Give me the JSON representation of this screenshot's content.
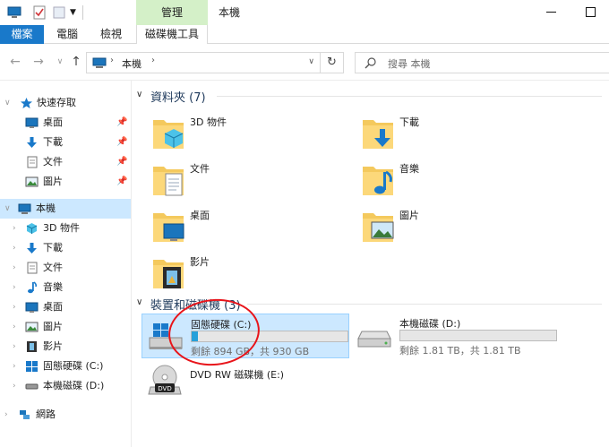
{
  "titlebar": {
    "context_group": "管理",
    "title": "本機"
  },
  "ribbon": {
    "tabs": [
      {
        "label": "檔案"
      },
      {
        "label": "電腦"
      },
      {
        "label": "檢視"
      },
      {
        "label": "磁碟機工具"
      }
    ]
  },
  "address": {
    "location": "本機"
  },
  "search": {
    "placeholder": "搜尋 本機"
  },
  "navpane": {
    "quick_access": "快速存取",
    "quick_items": [
      {
        "label": "桌面"
      },
      {
        "label": "下載"
      },
      {
        "label": "文件"
      },
      {
        "label": "圖片"
      }
    ],
    "this_pc": "本機",
    "pc_items": [
      {
        "label": "3D 物件"
      },
      {
        "label": "下載"
      },
      {
        "label": "文件"
      },
      {
        "label": "音樂"
      },
      {
        "label": "桌面"
      },
      {
        "label": "圖片"
      },
      {
        "label": "影片"
      },
      {
        "label": "固態硬碟 (C:)"
      },
      {
        "label": "本機磁碟 (D:)"
      }
    ],
    "network": "網路"
  },
  "folders_section": {
    "title": "資料夾 (7)",
    "items": [
      {
        "name": "3D 物件"
      },
      {
        "name": "下載"
      },
      {
        "name": "文件"
      },
      {
        "name": "音樂"
      },
      {
        "name": "桌面"
      },
      {
        "name": "圖片"
      },
      {
        "name": "影片"
      }
    ]
  },
  "devices_section": {
    "title": "裝置和磁碟機 (3)",
    "drives": [
      {
        "name": "固態硬碟 (C:)",
        "free": "剩餘 894 GB，共 930 GB",
        "used_fraction": 0.04
      },
      {
        "name": "本機磁碟 (D:)",
        "free": "剩餘 1.81 TB，共 1.81 TB",
        "used_fraction": 0.0
      },
      {
        "name": "DVD RW 磁碟機 (E:)"
      }
    ],
    "dvd_badge": "DVD"
  },
  "colors": {
    "accent": "#1979ca",
    "selection": "#cce8ff",
    "context_tab": "#d4f0c8",
    "progress": "#26a0da",
    "annotation": "#e8141a"
  }
}
